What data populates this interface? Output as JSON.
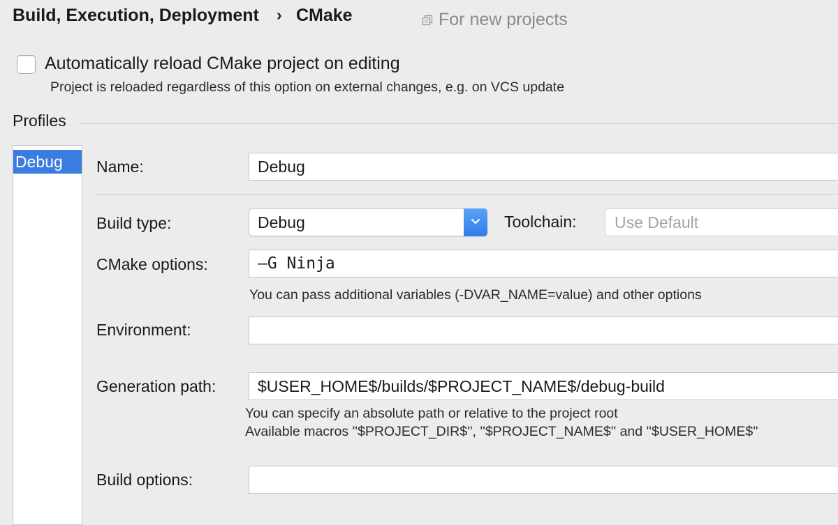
{
  "header": {
    "breadcrumb_parent": "Build, Execution, Deployment",
    "breadcrumb_separator": "›",
    "breadcrumb_current": "CMake",
    "scope_label": "For new projects"
  },
  "auto_reload": {
    "label": "Automatically reload CMake project on editing",
    "hint": "Project is reloaded regardless of this option on external changes, e.g. on VCS update",
    "checked": false
  },
  "profiles": {
    "section_label": "Profiles",
    "items": [
      {
        "label": "Debug",
        "selected": true
      }
    ]
  },
  "form": {
    "name_label": "Name:",
    "name_value": "Debug",
    "build_type_label": "Build type:",
    "build_type_value": "Debug",
    "toolchain_label": "Toolchain:",
    "toolchain_placeholder": "Use Default",
    "cmake_options_label": "CMake options:",
    "cmake_options_value": "–G Ninja",
    "cmake_options_hint": "You can pass additional variables (-DVAR_NAME=value) and other options",
    "environment_label": "Environment:",
    "environment_value": "",
    "generation_path_label": "Generation path:",
    "generation_path_value": "$USER_HOME$/builds/$PROJECT_NAME$/debug-build",
    "generation_path_hint_1": "You can specify an absolute path or relative to the project root",
    "generation_path_hint_2": "Available macros ''$PROJECT_DIR$'', ''$PROJECT_NAME$'' and ''$USER_HOME$''",
    "build_options_label": "Build options:",
    "build_options_value": ""
  },
  "colors": {
    "selection": "#3b7ce0",
    "dropdown_button": "#2f7de8",
    "background": "#ececec"
  }
}
